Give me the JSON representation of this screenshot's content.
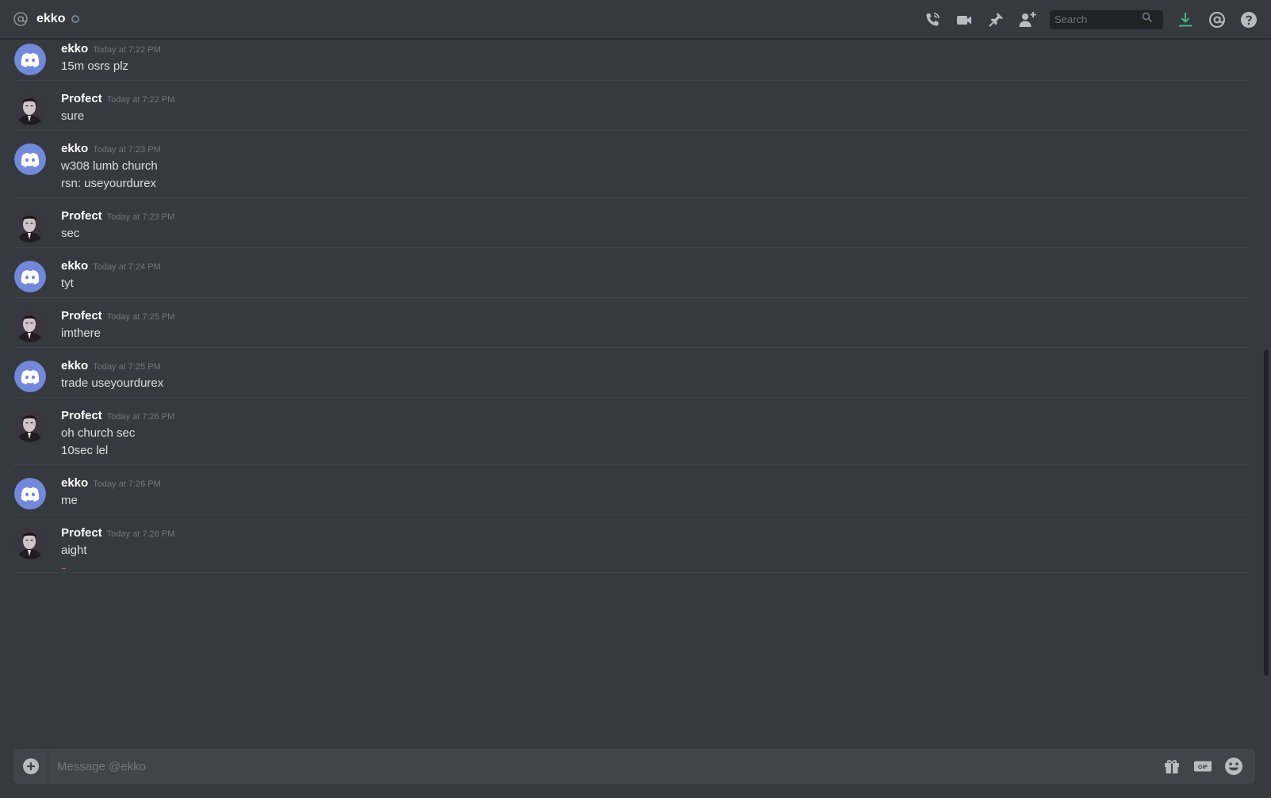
{
  "header": {
    "channel_name": "ekko",
    "search_placeholder": "Search"
  },
  "messages": [
    {
      "author": "ekko",
      "timestamp": "Today at 7:22 PM",
      "avatar": "discord-default-avatar",
      "lines": [
        "15m osrs plz"
      ]
    },
    {
      "author": "Profect",
      "timestamp": "Today at 7:22 PM",
      "avatar": "profile-photo-avatar",
      "lines": [
        "sure"
      ]
    },
    {
      "author": "ekko",
      "timestamp": "Today at 7:23 PM",
      "avatar": "discord-default-avatar",
      "lines": [
        "w308 lumb church",
        "rsn: useyourdurex"
      ]
    },
    {
      "author": "Profect",
      "timestamp": "Today at 7:23 PM",
      "avatar": "profile-photo-avatar",
      "lines": [
        "sec"
      ]
    },
    {
      "author": "ekko",
      "timestamp": "Today at 7:24 PM",
      "avatar": "discord-default-avatar",
      "lines": [
        "tyt"
      ]
    },
    {
      "author": "Profect",
      "timestamp": "Today at 7:25 PM",
      "avatar": "profile-photo-avatar",
      "lines": [
        "imthere"
      ]
    },
    {
      "author": "ekko",
      "timestamp": "Today at 7:25 PM",
      "avatar": "discord-default-avatar",
      "lines": [
        "trade useyourdurex"
      ]
    },
    {
      "author": "Profect",
      "timestamp": "Today at 7:26 PM",
      "avatar": "profile-photo-avatar",
      "lines": [
        "oh church sec",
        "10sec lel"
      ]
    },
    {
      "author": "ekko",
      "timestamp": "Today at 7:26 PM",
      "avatar": "discord-default-avatar",
      "lines": [
        "me"
      ]
    },
    {
      "author": "Profect",
      "timestamp": "Today at 7:26 PM",
      "avatar": "profile-photo-avatar",
      "lines": [
        "aight"
      ]
    }
  ],
  "composer": {
    "placeholder": "Message @ekko"
  },
  "colors": {
    "background": "#36393f",
    "discord_blurple": "#7289da",
    "download_green": "#43b581",
    "muted_text": "#72767d"
  }
}
